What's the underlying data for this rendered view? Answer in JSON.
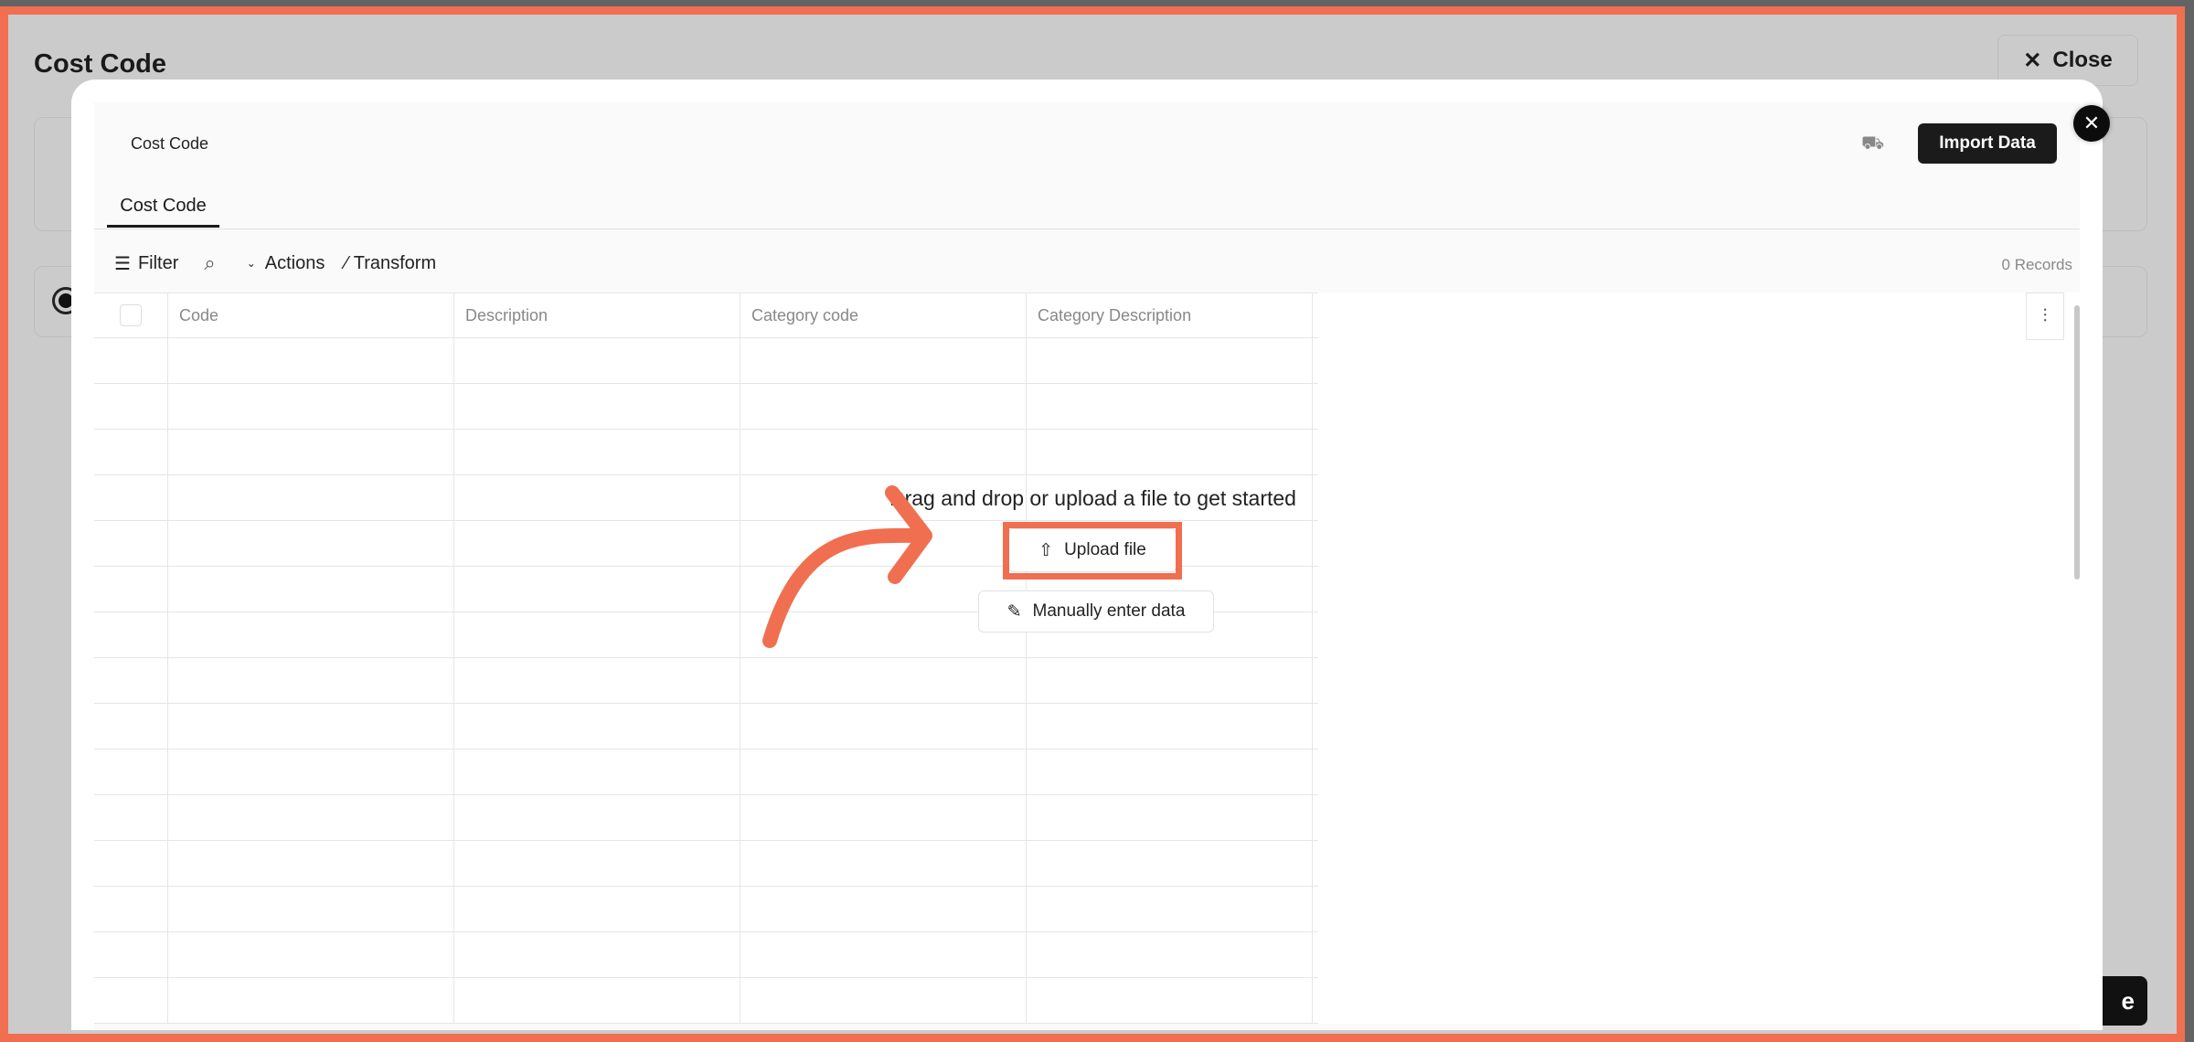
{
  "background": {
    "title": "Cost Code",
    "close_label": "Close",
    "partial_button_label": "e"
  },
  "modal": {
    "header_title": "Cost Code",
    "import_label": "Import Data",
    "tab": "Cost Code",
    "toolbar": {
      "filter": "Filter",
      "actions": "Actions",
      "transform": "Transform",
      "records": "0 Records"
    },
    "columns": [
      "Code",
      "Description",
      "Category code",
      "Category Description"
    ],
    "empty_state": {
      "message": "Drag and drop or upload a file to get started",
      "upload": "Upload file",
      "manual": "Manually enter data"
    }
  },
  "annotation_color": "#f06f50"
}
